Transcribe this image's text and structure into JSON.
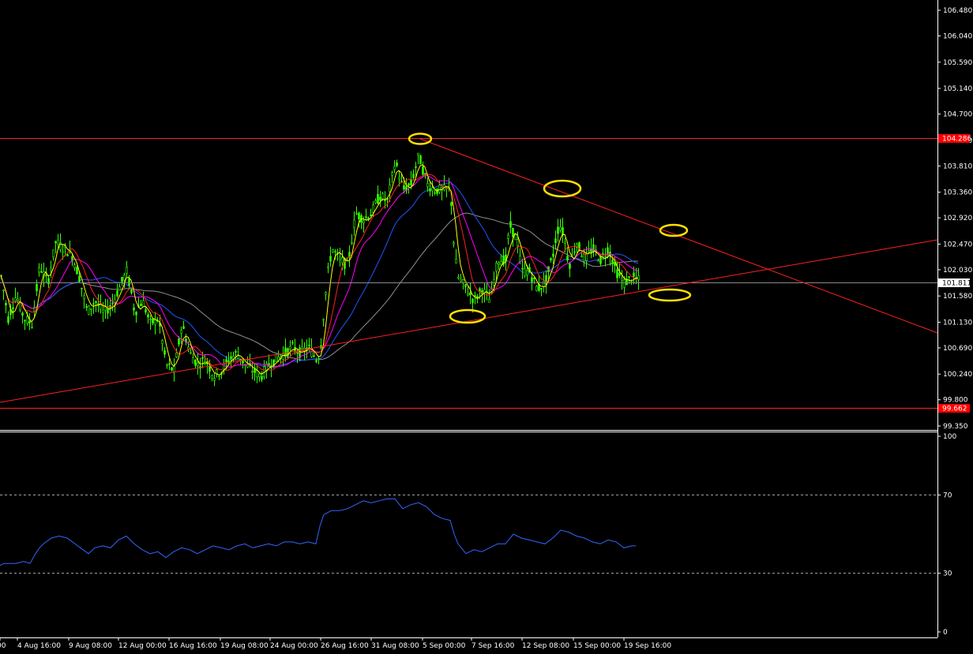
{
  "chart_data": [
    {
      "type": "candlestick",
      "panel": "price",
      "y_ticks": [
        "106.480",
        "106.040",
        "105.590",
        "105.140",
        "104.700",
        "104.250",
        "103.810",
        "103.360",
        "102.920",
        "102.470",
        "102.030",
        "101.580",
        "101.130",
        "100.690",
        "100.240",
        "99.800",
        "99.350"
      ],
      "ylim": [
        99.35,
        106.48
      ],
      "x_labels": [
        "00",
        "4 Aug 16:00",
        "9 Aug 08:00",
        "12 Aug 00:00",
        "16 Aug 16:00",
        "19 Aug 08:00",
        "24 Aug 00:00",
        "26 Aug 16:00",
        "31 Aug 08:00",
        "5 Sep 00:00",
        "7 Sep 16:00",
        "12 Sep 08:00",
        "15 Sep 00:00",
        "19 Sep 16:00"
      ],
      "resistance_level": {
        "label": "104.286",
        "value": 104.286
      },
      "support_level": {
        "label": "99.662",
        "value": 99.662
      },
      "current_price": {
        "label": "101.811",
        "value": 101.811
      },
      "colors": {
        "candles": "#33ff00",
        "fast_ma": "#ffff00",
        "mid_ma": "#ff2020",
        "slow_ma": "#ff00ff",
        "long_ma": "#2255ff",
        "longest_ma": "#909090",
        "trendlines": "#ff2020",
        "markers": "#ffe000"
      },
      "close_path": [
        [
          0,
          102.0
        ],
        [
          10,
          101.2
        ],
        [
          20,
          101.6
        ],
        [
          30,
          101.2
        ],
        [
          40,
          101.1
        ],
        [
          50,
          102.1
        ],
        [
          60,
          101.8
        ],
        [
          70,
          102.5
        ],
        [
          80,
          102.4
        ],
        [
          90,
          102.3
        ],
        [
          100,
          101.9
        ],
        [
          110,
          101.3
        ],
        [
          120,
          101.5
        ],
        [
          130,
          101.3
        ],
        [
          140,
          101.4
        ],
        [
          150,
          101.7
        ],
        [
          160,
          102.0
        ],
        [
          165,
          101.7
        ],
        [
          170,
          101.3
        ],
        [
          180,
          101.5
        ],
        [
          190,
          101.1
        ],
        [
          200,
          101.2
        ],
        [
          210,
          100.4
        ],
        [
          220,
          100.3
        ],
        [
          230,
          101.1
        ],
        [
          240,
          100.6
        ],
        [
          250,
          100.4
        ],
        [
          260,
          100.5
        ],
        [
          270,
          100.2
        ],
        [
          280,
          100.3
        ],
        [
          290,
          100.5
        ],
        [
          300,
          100.6
        ],
        [
          310,
          100.4
        ],
        [
          320,
          100.3
        ],
        [
          330,
          100.2
        ],
        [
          340,
          100.4
        ],
        [
          350,
          100.5
        ],
        [
          360,
          100.6
        ],
        [
          370,
          100.7
        ],
        [
          380,
          100.6
        ],
        [
          390,
          100.7
        ],
        [
          400,
          100.5
        ],
        [
          405,
          100.6
        ],
        [
          410,
          101.4
        ],
        [
          415,
          102.0
        ],
        [
          420,
          102.4
        ],
        [
          430,
          102.2
        ],
        [
          440,
          102.1
        ],
        [
          450,
          103.0
        ],
        [
          460,
          102.9
        ],
        [
          470,
          103.0
        ],
        [
          480,
          103.3
        ],
        [
          490,
          103.2
        ],
        [
          500,
          103.9
        ],
        [
          510,
          103.4
        ],
        [
          520,
          103.5
        ],
        [
          530,
          104.0
        ],
        [
          540,
          103.5
        ],
        [
          550,
          103.4
        ],
        [
          560,
          103.4
        ],
        [
          570,
          103.4
        ],
        [
          575,
          102.3
        ],
        [
          580,
          101.9
        ],
        [
          590,
          101.7
        ],
        [
          600,
          101.5
        ],
        [
          610,
          101.7
        ],
        [
          620,
          101.5
        ],
        [
          630,
          102.2
        ],
        [
          640,
          102.2
        ],
        [
          645,
          102.8
        ],
        [
          655,
          102.5
        ],
        [
          660,
          102.0
        ],
        [
          670,
          102.0
        ],
        [
          680,
          101.7
        ],
        [
          690,
          101.8
        ],
        [
          700,
          102.3
        ],
        [
          705,
          102.7
        ],
        [
          710,
          102.8
        ],
        [
          715,
          102.5
        ],
        [
          720,
          102.1
        ],
        [
          730,
          102.5
        ],
        [
          740,
          102.2
        ],
        [
          750,
          102.4
        ],
        [
          760,
          102.2
        ],
        [
          770,
          102.4
        ],
        [
          780,
          102.0
        ],
        [
          790,
          101.8
        ],
        [
          800,
          101.9
        ],
        [
          808,
          101.85
        ]
      ]
    },
    {
      "type": "line",
      "panel": "oscillator",
      "y_ticks": [
        "100",
        "70",
        "30",
        "0"
      ],
      "ylim": [
        0,
        100
      ],
      "levels": [
        70,
        30
      ],
      "color": "#3366ff",
      "x": [
        0,
        5,
        10,
        20,
        30,
        38,
        45,
        50,
        55,
        65,
        75,
        85,
        95,
        105,
        112,
        120,
        130,
        140,
        150,
        160,
        170,
        180,
        190,
        200,
        210,
        220,
        230,
        240,
        250,
        260,
        270,
        280,
        290,
        300,
        310,
        320,
        330,
        340,
        350,
        360,
        370,
        380,
        390,
        400,
        405,
        410,
        415,
        420,
        430,
        440,
        450,
        460,
        470,
        480,
        490,
        500,
        510,
        520,
        530,
        540,
        550,
        560,
        570,
        575,
        580,
        590,
        600,
        610,
        620,
        630,
        640,
        650,
        660,
        670,
        680,
        690,
        700,
        710,
        720,
        730,
        740,
        750,
        760,
        770,
        780,
        790,
        800,
        805
      ],
      "values": [
        34,
        35,
        35,
        35,
        36,
        35,
        40,
        43,
        45,
        48,
        49,
        48,
        45,
        42,
        40,
        43,
        44,
        43,
        47,
        49,
        45,
        42,
        40,
        41,
        38,
        41,
        43,
        42,
        40,
        42,
        44,
        43,
        42,
        44,
        45,
        43,
        44,
        45,
        44,
        46,
        46,
        45,
        46,
        45,
        54,
        60,
        61,
        62,
        62,
        63,
        65,
        67,
        66,
        67,
        68,
        68,
        63,
        65,
        66,
        64,
        60,
        58,
        57,
        50,
        45,
        40,
        42,
        41,
        43,
        45,
        45,
        50,
        48,
        47,
        46,
        45,
        48,
        52,
        51,
        49,
        48,
        46,
        45,
        47,
        46,
        43,
        44,
        44
      ]
    }
  ]
}
